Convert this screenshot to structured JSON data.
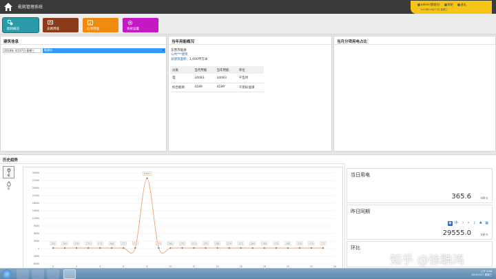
{
  "app": {
    "title": "能耗管理系统"
  },
  "user_panel": {
    "user": "admin(管理员)",
    "help": "帮助",
    "logout": "退出",
    "datetime": "2019年04月17日 星期三"
  },
  "nav": [
    {
      "label": "能耗概况",
      "color": "#2a9aa8"
    },
    {
      "label": "支路用能",
      "color": "#8b3a1a"
    },
    {
      "label": "分项用能",
      "color": "#f08a10"
    },
    {
      "label": "系统设置",
      "color": "#c418c4"
    }
  ],
  "building_info": {
    "title": "建筑信息",
    "date": "2019年 4月17日 星期三",
    "building": "能源站"
  },
  "annual": {
    "title": "当年用能概况",
    "org": "东营市能源",
    "type": "公共***建筑",
    "area_label": "总建筑面积：",
    "area_value": "1,000平方米",
    "headers": [
      "分类",
      "当月用能",
      "当年用能",
      "单位"
    ],
    "rows": [
      [
        "电",
        "34083",
        "34083",
        "千瓦时"
      ],
      [
        "综合能耗",
        "4189",
        "4189",
        "千克标准煤"
      ]
    ]
  },
  "monthly": {
    "title": "当月分项用电占比"
  },
  "history": {
    "title": "历史趋势",
    "tabs": [
      {
        "label": "电"
      },
      {
        "label": "水"
      }
    ]
  },
  "chart_data": {
    "type": "line",
    "x": [
      0,
      1,
      2,
      3,
      4,
      5,
      6,
      7,
      8,
      9,
      10,
      11,
      12,
      13,
      14,
      15,
      16,
      17,
      18,
      19,
      20,
      21,
      22,
      23
    ],
    "values": [
      263,
      269,
      278,
      274,
      273,
      268,
      272,
      270,
      27877,
      274,
      266,
      279,
      273,
      275,
      285,
      274,
      271,
      269,
      269,
      270,
      268,
      270,
      274,
      272
    ],
    "data_labels": [
      "263",
      "269",
      "278",
      "274",
      "273",
      "268",
      "272",
      "270",
      "27877",
      "274",
      "266",
      "279",
      "273",
      "275",
      "285",
      "274",
      "271",
      "269",
      "269",
      "270",
      "268",
      "270",
      "274",
      "272"
    ],
    "xticks": [
      "0",
      "2",
      "4",
      "6",
      "8",
      "10",
      "12",
      "14",
      "16",
      "18",
      "20",
      "22",
      "24"
    ],
    "yticks": [
      "30000",
      "27000",
      "24000",
      "21000",
      "18000",
      "15000",
      "12000",
      "9000",
      "6000",
      "3000",
      "0",
      "-3000",
      "-6000"
    ],
    "ylim": [
      -6000,
      30000
    ],
    "xlim": [
      -1,
      24
    ],
    "grid": true,
    "line_color": "#f0a070",
    "point_color": "#888888"
  },
  "stats": {
    "today": {
      "label": "当日用电",
      "value": "365.6",
      "unit": "kW·h"
    },
    "yesterday": {
      "label": "昨日同期",
      "value": "29555.0",
      "unit": "kW·h"
    },
    "ratio": {
      "label": "环比"
    }
  },
  "taskbar": {
    "time": "上午 9:06",
    "date": "2019/4/17 星期三"
  },
  "watermark": "知乎 @徐聃鸿"
}
